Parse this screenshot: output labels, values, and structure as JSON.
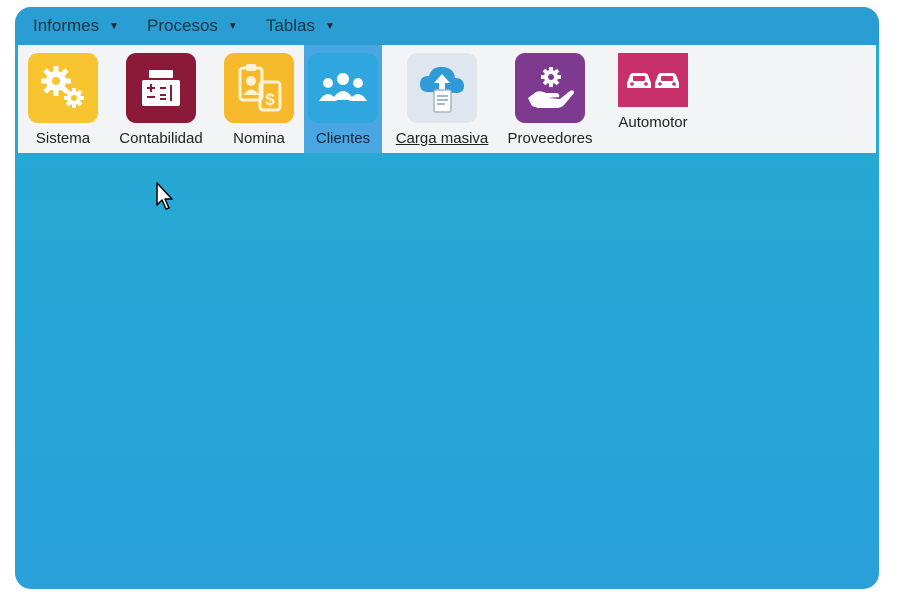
{
  "menubar": {
    "items": [
      {
        "label": "Informes"
      },
      {
        "label": "Procesos"
      },
      {
        "label": "Tablas"
      }
    ]
  },
  "toolbar": {
    "items": [
      {
        "label": "Sistema",
        "icon": "gears-icon",
        "color": "#f7c32e"
      },
      {
        "label": "Contabilidad",
        "icon": "calculator-icon",
        "color": "#8b1a3a"
      },
      {
        "label": "Nomina",
        "icon": "id-badge-icon",
        "color": "#f6b92b"
      },
      {
        "label": "Clientes",
        "icon": "users-icon",
        "color": "#2fa7de",
        "state": "selected"
      },
      {
        "label": "Carga masiva",
        "icon": "cloud-upload-icon",
        "color": "#dfe6ee",
        "state": "hover"
      },
      {
        "label": "Proveedores",
        "icon": "hand-gear-icon",
        "color": "#7d3a8e"
      },
      {
        "label": "Automotor",
        "icon": "cars-icon",
        "color": "#c8306b"
      }
    ]
  }
}
